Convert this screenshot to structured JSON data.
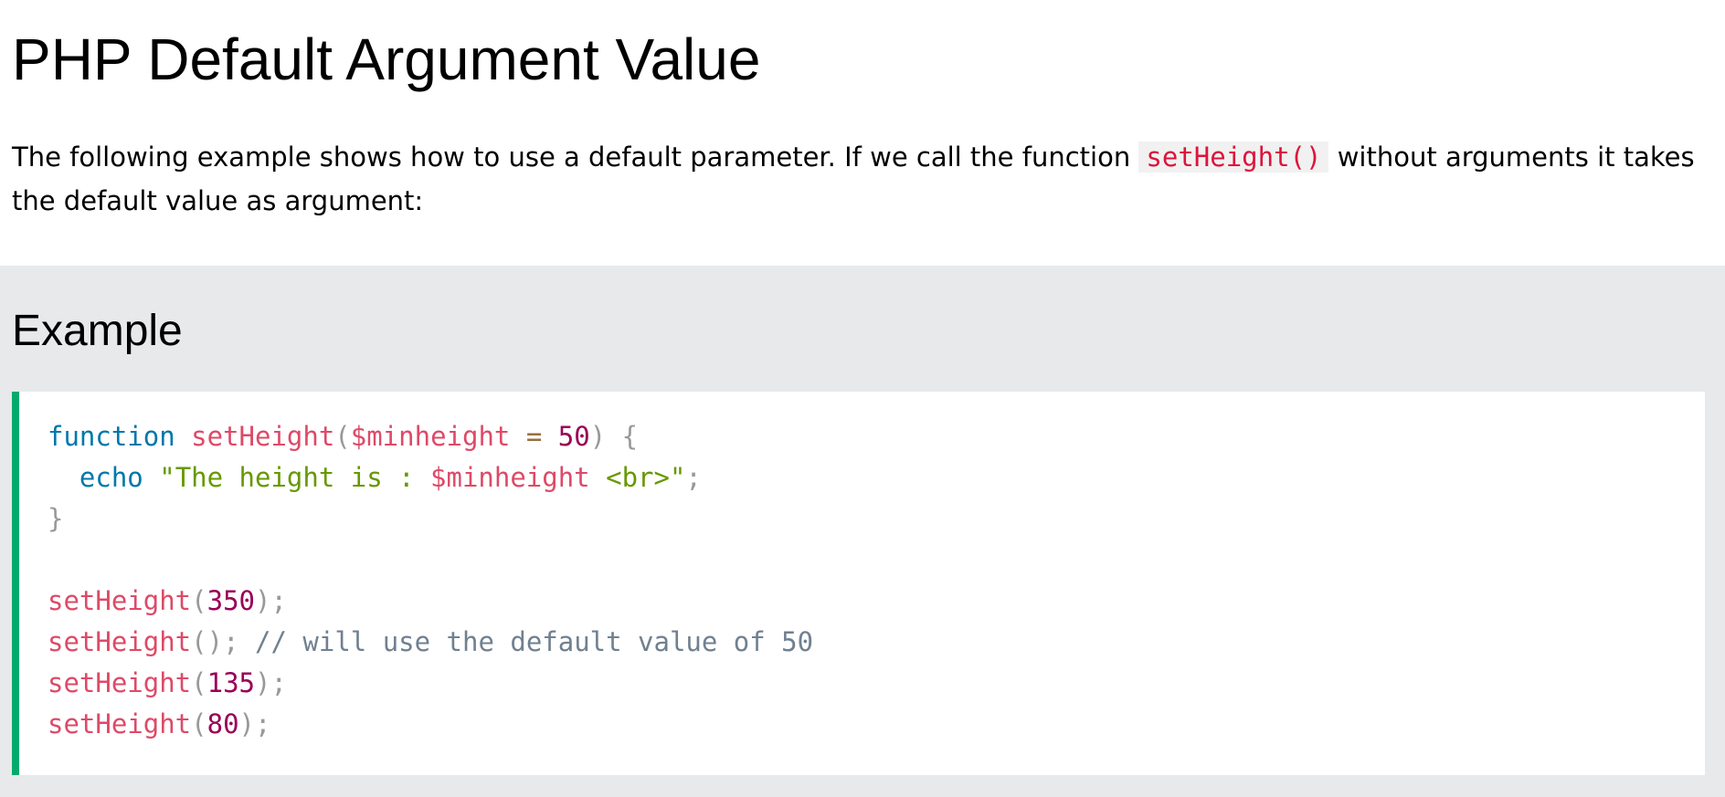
{
  "page": {
    "title": "PHP Default Argument Value",
    "intro": {
      "before": "The following example shows how to use a default parameter. If we call the function ",
      "code": "setHeight()",
      "after": " without arguments it takes the default value as argument:"
    }
  },
  "example": {
    "heading": "Example",
    "accent_color": "#04aa6d",
    "lines": [
      [
        {
          "t": "function",
          "c": "kw"
        },
        {
          "t": " ",
          "c": ""
        },
        {
          "t": "setHeight",
          "c": "fn"
        },
        {
          "t": "(",
          "c": "pu"
        },
        {
          "t": "$minheight",
          "c": "va"
        },
        {
          "t": " ",
          "c": ""
        },
        {
          "t": "=",
          "c": "op"
        },
        {
          "t": " ",
          "c": ""
        },
        {
          "t": "50",
          "c": "nu"
        },
        {
          "t": ")",
          "c": "pu"
        },
        {
          "t": " ",
          "c": ""
        },
        {
          "t": "{",
          "c": "pu"
        }
      ],
      [
        {
          "t": "  ",
          "c": ""
        },
        {
          "t": "echo",
          "c": "kw"
        },
        {
          "t": " ",
          "c": ""
        },
        {
          "t": "\"The height is : ",
          "c": "st"
        },
        {
          "t": "$minheight",
          "c": "va"
        },
        {
          "t": " <br>\"",
          "c": "st"
        },
        {
          "t": ";",
          "c": "pu"
        }
      ],
      [
        {
          "t": "}",
          "c": "pu"
        }
      ],
      [],
      [
        {
          "t": "setHeight",
          "c": "fn"
        },
        {
          "t": "(",
          "c": "pu"
        },
        {
          "t": "350",
          "c": "nu"
        },
        {
          "t": ")",
          "c": "pu"
        },
        {
          "t": ";",
          "c": "pu"
        }
      ],
      [
        {
          "t": "setHeight",
          "c": "fn"
        },
        {
          "t": "(",
          "c": "pu"
        },
        {
          "t": ")",
          "c": "pu"
        },
        {
          "t": ";",
          "c": "pu"
        },
        {
          "t": " ",
          "c": ""
        },
        {
          "t": "// will use the default value of 50",
          "c": "cm"
        }
      ],
      [
        {
          "t": "setHeight",
          "c": "fn"
        },
        {
          "t": "(",
          "c": "pu"
        },
        {
          "t": "135",
          "c": "nu"
        },
        {
          "t": ")",
          "c": "pu"
        },
        {
          "t": ";",
          "c": "pu"
        }
      ],
      [
        {
          "t": "setHeight",
          "c": "fn"
        },
        {
          "t": "(",
          "c": "pu"
        },
        {
          "t": "80",
          "c": "nu"
        },
        {
          "t": ")",
          "c": "pu"
        },
        {
          "t": ";",
          "c": "pu"
        }
      ]
    ]
  }
}
